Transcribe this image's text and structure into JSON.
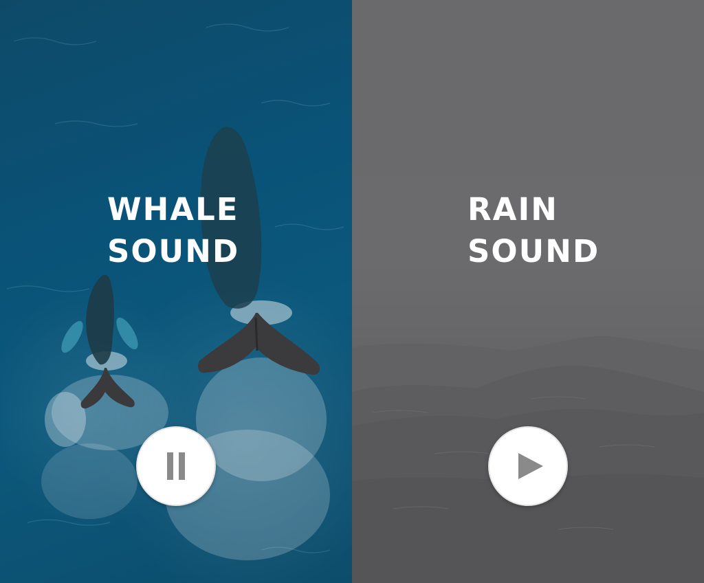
{
  "panels": [
    {
      "id": "whale",
      "title_line1": "WHALE",
      "title_line2": "SOUND",
      "control": "pause",
      "control_icon": "pause-icon",
      "state": "playing",
      "background_color": "#0b587c"
    },
    {
      "id": "rain",
      "title_line1": "RAIN",
      "title_line2": "SOUND",
      "control": "play",
      "control_icon": "play-icon",
      "state": "paused",
      "background_color": "#666668"
    }
  ],
  "colors": {
    "text": "#ffffff",
    "button_bg": "#ffffff",
    "icon": "#8a8a8a"
  }
}
